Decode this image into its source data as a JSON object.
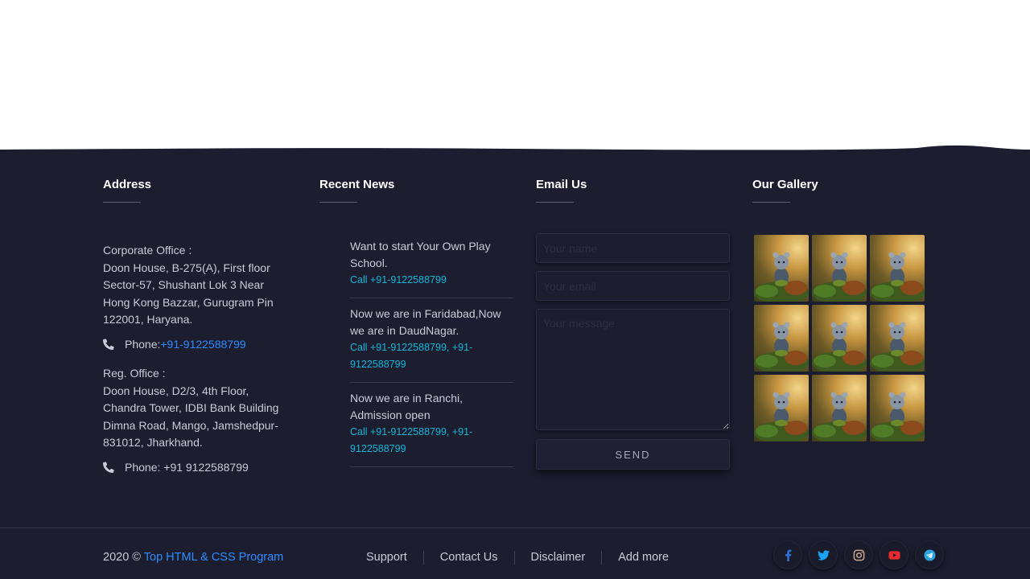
{
  "address": {
    "title": "Address",
    "corporate_label": "Corporate Office :",
    "corporate_lines": [
      "Doon House, B-275(A), First floor",
      "Sector-57, Shushant Lok 3 Near",
      "Hong Kong Bazzar, Gurugram Pin",
      "122001, Haryana."
    ],
    "corporate_phone_label": "Phone: ",
    "corporate_phone": "+91-9122588799",
    "reg_label": "Reg. Office :",
    "reg_lines": [
      "Doon House, D2/3, 4th Floor,",
      "Chandra Tower, IDBI Bank Building",
      "Dimna Road, Mango, Jamshedpur-",
      "831012, Jharkhand."
    ],
    "reg_phone": "Phone: +91 9122588799"
  },
  "news": {
    "title": "Recent News",
    "items": [
      {
        "text": "Want to start Your Own Play School.",
        "call": "Call +91-9122588799"
      },
      {
        "text": "Now we are in Faridabad,Now we are in DaudNagar.",
        "call": "Call +91-9122588799, +91-9122588799"
      },
      {
        "text": "Now we are in Ranchi, Admission open",
        "call": "Call +91-9122588799, +91-9122588799"
      }
    ]
  },
  "email": {
    "title": "Email Us",
    "name_placeholder": "Your name",
    "email_placeholder": "Your email",
    "message_placeholder": "Your message",
    "send_label": "SEND"
  },
  "gallery": {
    "title": "Our Gallery",
    "count": 9
  },
  "bottom": {
    "year": "2020 © ",
    "brand": "Top HTML & CSS Program",
    "links": [
      "Support",
      "Contact Us",
      "Disclaimer",
      "Add more"
    ],
    "social_icons": [
      "facebook-icon",
      "twitter-icon",
      "instagram-icon",
      "youtube-icon",
      "telegram-icon"
    ]
  },
  "colors": {
    "background": "#1c1d2f",
    "accent_blue": "#2f8cff",
    "accent_cyan": "#15b7d9",
    "youtube_red": "#e62b2b"
  }
}
